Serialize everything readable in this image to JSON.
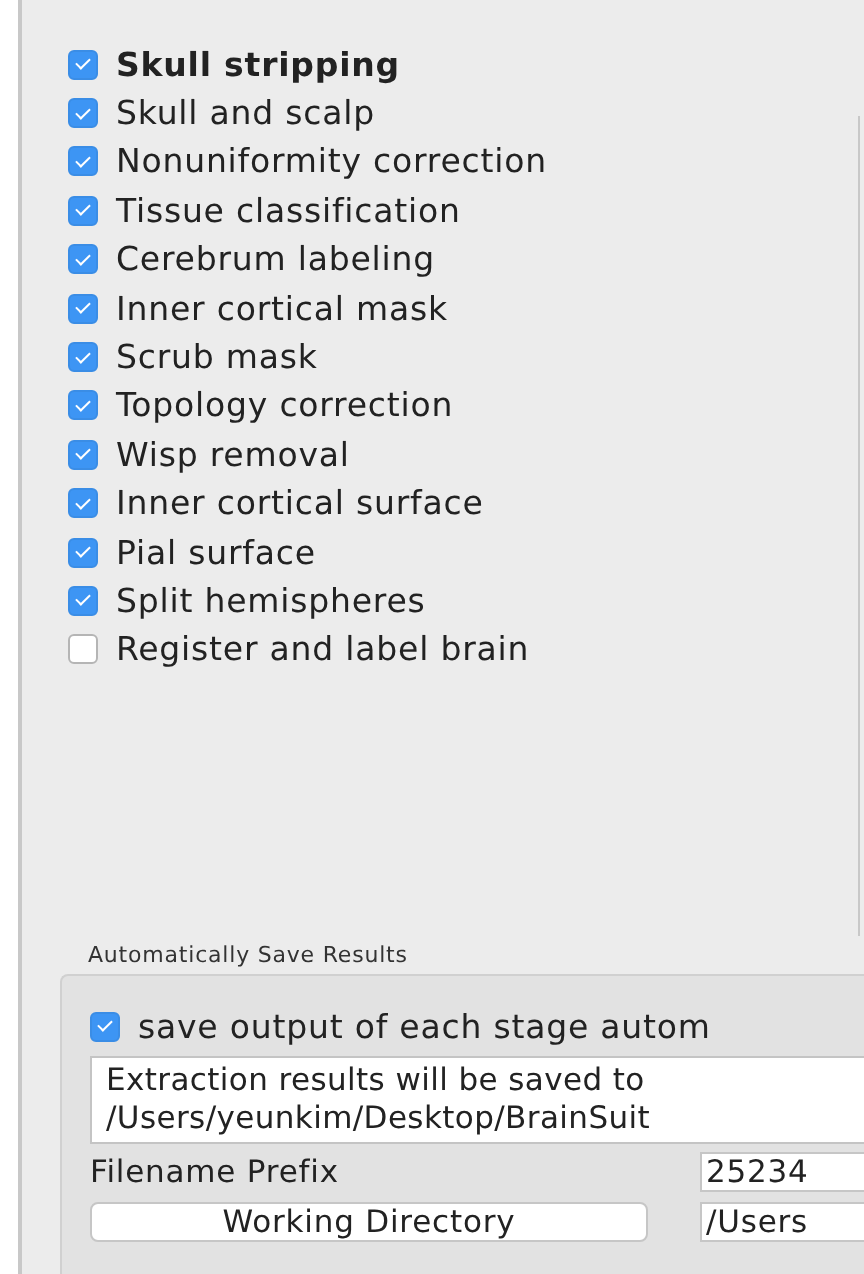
{
  "stages": [
    {
      "label": "Skull stripping",
      "kind": "group",
      "checked": true
    },
    {
      "label": "Skull and scalp",
      "kind": "step",
      "checked": true
    },
    {
      "label": "Nonuniformity correction",
      "kind": "step",
      "checked": true
    },
    {
      "label": "Tissue classification",
      "kind": "step",
      "checked": true
    },
    {
      "label": "Cerebrum labeling",
      "kind": "step",
      "checked": true
    },
    {
      "label": "Inner cortical mask",
      "kind": "step",
      "checked": true
    },
    {
      "label": "Scrub mask",
      "kind": "step",
      "checked": true
    },
    {
      "label": "Topology correction",
      "kind": "step",
      "checked": true
    },
    {
      "label": "Wisp removal",
      "kind": "step",
      "checked": true
    },
    {
      "label": "Inner cortical surface",
      "kind": "step",
      "checked": true
    },
    {
      "label": "Pial surface",
      "kind": "step",
      "checked": true
    },
    {
      "label": "Split hemispheres",
      "kind": "step",
      "checked": true
    },
    {
      "label": "Register and label brain",
      "kind": "step",
      "checked": false
    }
  ],
  "autosave": {
    "title": "Automatically Save Results",
    "option": {
      "label": "save output of each stage autom",
      "checked": true
    },
    "message": [
      "Extraction results will be saved to",
      "/Users/yeunkim/Desktop/BrainSuit"
    ],
    "prefix_label": "Filename Prefix",
    "prefix_value": "25234",
    "directory_button": "Working Directory",
    "directory_value": "/Users"
  }
}
